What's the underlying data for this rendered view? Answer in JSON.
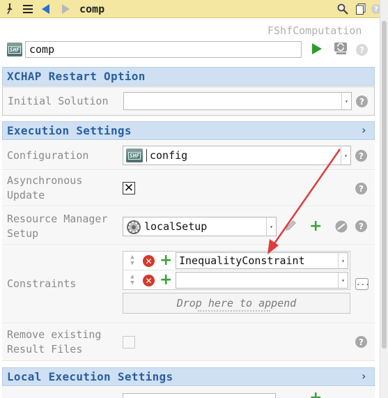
{
  "toolbar": {
    "title": "comp",
    "icons": [
      "pin-icon",
      "menu-icon",
      "back-arrow-icon",
      "forward-arrow-icon",
      "search-icon",
      "copy-icon",
      "help-icon"
    ]
  },
  "header": {
    "type_label": "FShfComputation",
    "name_value": "comp",
    "badge_text": "SHF"
  },
  "xchap": {
    "title": "XCHAP Restart Option",
    "initial_solution_label": "Initial Solution",
    "initial_solution_value": ""
  },
  "execution": {
    "title": "Execution Settings",
    "configuration_label": "Configuration",
    "configuration_value": "config",
    "async_label_1": "Asynchronous",
    "async_label_2": "Update",
    "async_checked": true,
    "async_mark": "✕",
    "resource_label_1": "Resource Manager",
    "resource_label_2": "Setup",
    "resource_value": "localSetup",
    "constraints_label": "Constraints",
    "constraints": [
      "InequalityConstraint",
      ""
    ],
    "drop_hint": "Drop here to append",
    "more_button": "...",
    "remove_label_1": "Remove existing",
    "remove_label_2": "Result Files",
    "remove_checked": false
  },
  "local_execution": {
    "title": "Local Execution Settings"
  },
  "colors": {
    "toolbar_bg": "#f3e7a1",
    "section_bg": "#cfe0f3",
    "section_text": "#2a5f9e",
    "arrow_annotation": "#e03a3a",
    "add_green": "#3aa43a",
    "remove_red": "#d43a2a"
  }
}
